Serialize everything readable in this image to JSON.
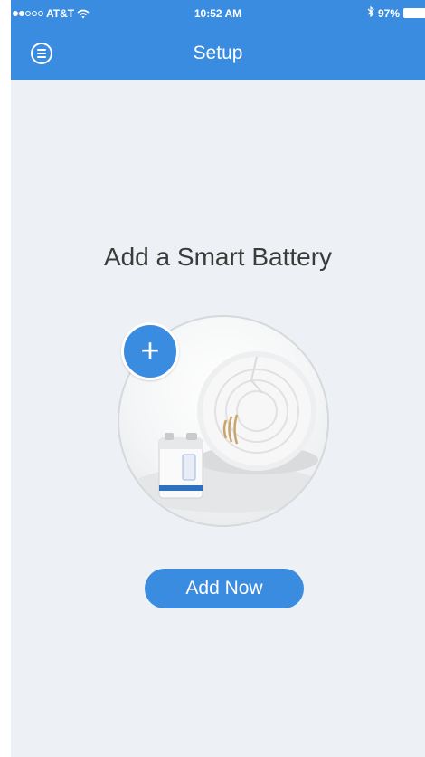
{
  "status_bar": {
    "carrier": "AT&T",
    "time": "10:52 AM",
    "battery_percent": "97%",
    "signal_bars_filled": 2,
    "signal_bars_total": 5,
    "icons": [
      "wifi-icon",
      "bluetooth-icon",
      "battery-icon"
    ]
  },
  "nav": {
    "title": "Setup",
    "menu_icon": "menu-icon"
  },
  "main": {
    "heading": "Add a Smart Battery",
    "add_icon_label": "+",
    "primary_button_label": "Add Now"
  },
  "colors": {
    "accent": "#3a8ce0",
    "background": "#edf0f4",
    "heading_text": "#3b3b3b"
  }
}
